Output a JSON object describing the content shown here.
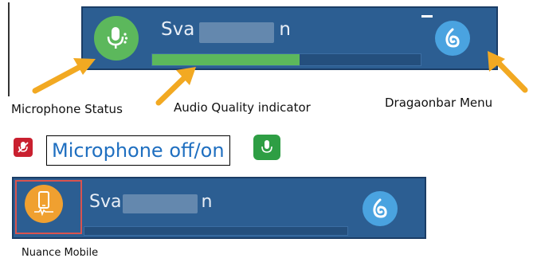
{
  "bar1": {
    "user_prefix": "Sva",
    "user_suffix": "n",
    "audio_quality_level": 0.55,
    "icons": {
      "mic": "microphone-icon",
      "dragon": "dragon-menu-icon",
      "minimize": "minimize-icon"
    }
  },
  "labels": {
    "microphone_status": "Microphone Status",
    "audio_quality": "Audio Quality indicator",
    "dragonbar_menu": "Dragaonbar Menu",
    "mic_toggle": "Microphone off/on",
    "nuance_mobile": "Nuance Mobile"
  },
  "bar2": {
    "user_prefix": "Sva",
    "user_suffix": "n",
    "audio_quality_level": 0,
    "icons": {
      "mic": "mobile-phone-icon",
      "dragon": "dragon-menu-icon"
    }
  },
  "colors": {
    "bar_bg": "#2c5e92",
    "mic_on": "#5cb85c",
    "mic_off": "#c9202f",
    "mobile": "#f0a030",
    "dragon": "#4aa3e0",
    "arrow": "#f2a922",
    "toggle_text": "#1f6fc0",
    "highlight_box": "#d9534f"
  }
}
